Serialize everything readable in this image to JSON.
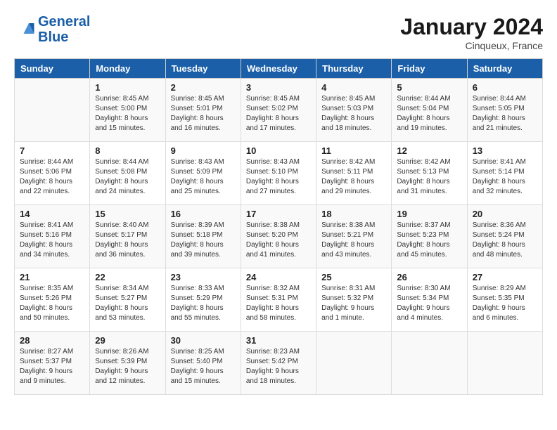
{
  "header": {
    "logo_line1": "General",
    "logo_line2": "Blue",
    "month": "January 2024",
    "location": "Cinqueux, France"
  },
  "columns": [
    "Sunday",
    "Monday",
    "Tuesday",
    "Wednesday",
    "Thursday",
    "Friday",
    "Saturday"
  ],
  "weeks": [
    [
      {
        "day": "",
        "detail": ""
      },
      {
        "day": "1",
        "detail": "Sunrise: 8:45 AM\nSunset: 5:00 PM\nDaylight: 8 hours\nand 15 minutes."
      },
      {
        "day": "2",
        "detail": "Sunrise: 8:45 AM\nSunset: 5:01 PM\nDaylight: 8 hours\nand 16 minutes."
      },
      {
        "day": "3",
        "detail": "Sunrise: 8:45 AM\nSunset: 5:02 PM\nDaylight: 8 hours\nand 17 minutes."
      },
      {
        "day": "4",
        "detail": "Sunrise: 8:45 AM\nSunset: 5:03 PM\nDaylight: 8 hours\nand 18 minutes."
      },
      {
        "day": "5",
        "detail": "Sunrise: 8:44 AM\nSunset: 5:04 PM\nDaylight: 8 hours\nand 19 minutes."
      },
      {
        "day": "6",
        "detail": "Sunrise: 8:44 AM\nSunset: 5:05 PM\nDaylight: 8 hours\nand 21 minutes."
      }
    ],
    [
      {
        "day": "7",
        "detail": "Sunrise: 8:44 AM\nSunset: 5:06 PM\nDaylight: 8 hours\nand 22 minutes."
      },
      {
        "day": "8",
        "detail": "Sunrise: 8:44 AM\nSunset: 5:08 PM\nDaylight: 8 hours\nand 24 minutes."
      },
      {
        "day": "9",
        "detail": "Sunrise: 8:43 AM\nSunset: 5:09 PM\nDaylight: 8 hours\nand 25 minutes."
      },
      {
        "day": "10",
        "detail": "Sunrise: 8:43 AM\nSunset: 5:10 PM\nDaylight: 8 hours\nand 27 minutes."
      },
      {
        "day": "11",
        "detail": "Sunrise: 8:42 AM\nSunset: 5:11 PM\nDaylight: 8 hours\nand 29 minutes."
      },
      {
        "day": "12",
        "detail": "Sunrise: 8:42 AM\nSunset: 5:13 PM\nDaylight: 8 hours\nand 31 minutes."
      },
      {
        "day": "13",
        "detail": "Sunrise: 8:41 AM\nSunset: 5:14 PM\nDaylight: 8 hours\nand 32 minutes."
      }
    ],
    [
      {
        "day": "14",
        "detail": "Sunrise: 8:41 AM\nSunset: 5:16 PM\nDaylight: 8 hours\nand 34 minutes."
      },
      {
        "day": "15",
        "detail": "Sunrise: 8:40 AM\nSunset: 5:17 PM\nDaylight: 8 hours\nand 36 minutes."
      },
      {
        "day": "16",
        "detail": "Sunrise: 8:39 AM\nSunset: 5:18 PM\nDaylight: 8 hours\nand 39 minutes."
      },
      {
        "day": "17",
        "detail": "Sunrise: 8:38 AM\nSunset: 5:20 PM\nDaylight: 8 hours\nand 41 minutes."
      },
      {
        "day": "18",
        "detail": "Sunrise: 8:38 AM\nSunset: 5:21 PM\nDaylight: 8 hours\nand 43 minutes."
      },
      {
        "day": "19",
        "detail": "Sunrise: 8:37 AM\nSunset: 5:23 PM\nDaylight: 8 hours\nand 45 minutes."
      },
      {
        "day": "20",
        "detail": "Sunrise: 8:36 AM\nSunset: 5:24 PM\nDaylight: 8 hours\nand 48 minutes."
      }
    ],
    [
      {
        "day": "21",
        "detail": "Sunrise: 8:35 AM\nSunset: 5:26 PM\nDaylight: 8 hours\nand 50 minutes."
      },
      {
        "day": "22",
        "detail": "Sunrise: 8:34 AM\nSunset: 5:27 PM\nDaylight: 8 hours\nand 53 minutes."
      },
      {
        "day": "23",
        "detail": "Sunrise: 8:33 AM\nSunset: 5:29 PM\nDaylight: 8 hours\nand 55 minutes."
      },
      {
        "day": "24",
        "detail": "Sunrise: 8:32 AM\nSunset: 5:31 PM\nDaylight: 8 hours\nand 58 minutes."
      },
      {
        "day": "25",
        "detail": "Sunrise: 8:31 AM\nSunset: 5:32 PM\nDaylight: 9 hours\nand 1 minute."
      },
      {
        "day": "26",
        "detail": "Sunrise: 8:30 AM\nSunset: 5:34 PM\nDaylight: 9 hours\nand 4 minutes."
      },
      {
        "day": "27",
        "detail": "Sunrise: 8:29 AM\nSunset: 5:35 PM\nDaylight: 9 hours\nand 6 minutes."
      }
    ],
    [
      {
        "day": "28",
        "detail": "Sunrise: 8:27 AM\nSunset: 5:37 PM\nDaylight: 9 hours\nand 9 minutes."
      },
      {
        "day": "29",
        "detail": "Sunrise: 8:26 AM\nSunset: 5:39 PM\nDaylight: 9 hours\nand 12 minutes."
      },
      {
        "day": "30",
        "detail": "Sunrise: 8:25 AM\nSunset: 5:40 PM\nDaylight: 9 hours\nand 15 minutes."
      },
      {
        "day": "31",
        "detail": "Sunrise: 8:23 AM\nSunset: 5:42 PM\nDaylight: 9 hours\nand 18 minutes."
      },
      {
        "day": "",
        "detail": ""
      },
      {
        "day": "",
        "detail": ""
      },
      {
        "day": "",
        "detail": ""
      }
    ]
  ]
}
